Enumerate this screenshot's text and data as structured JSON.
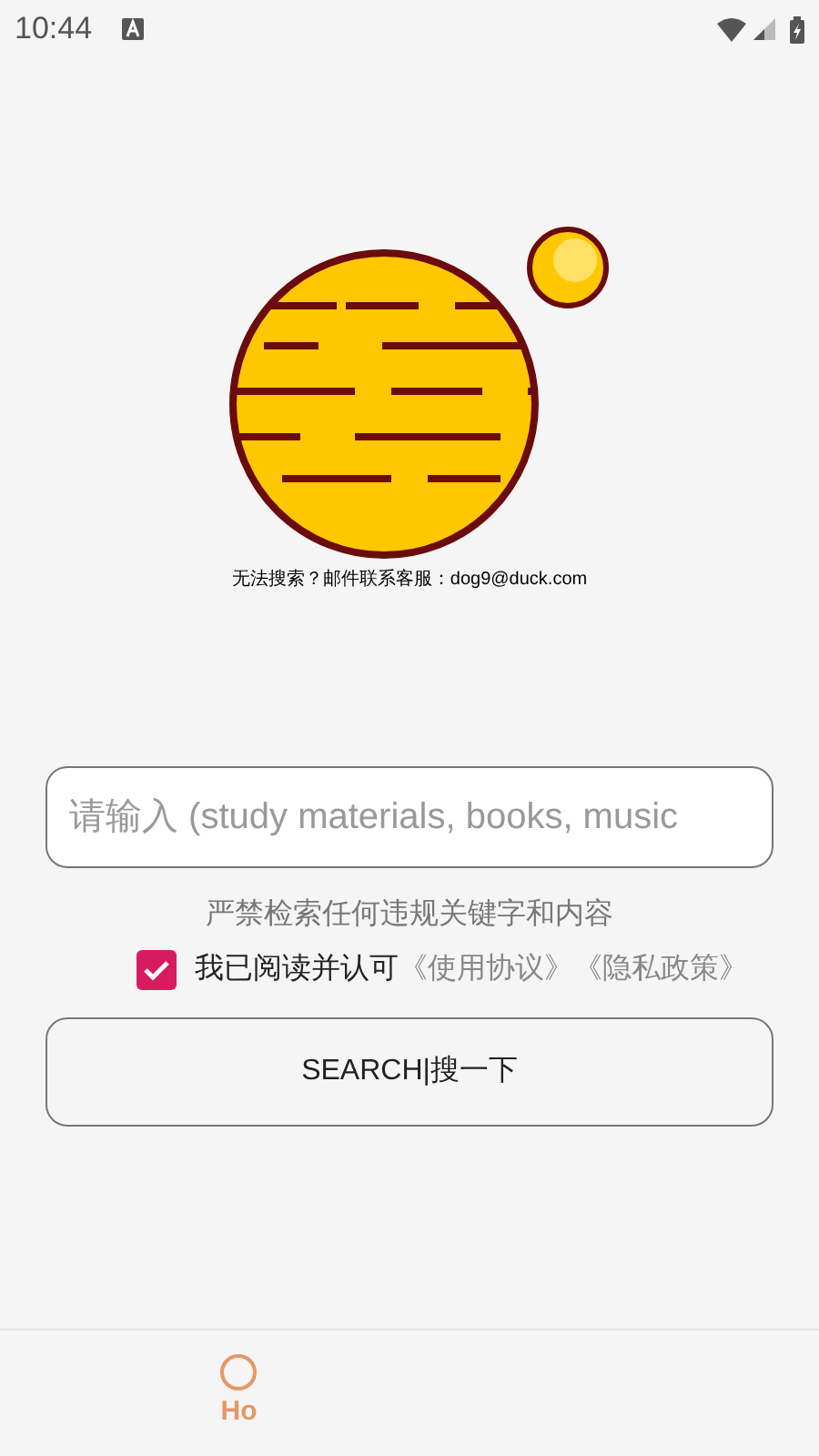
{
  "status_bar": {
    "time": "10:44"
  },
  "contact_note": "无法搜索？邮件联系客服：dog9@duck.com",
  "search": {
    "placeholder": "请输入 (study materials, books, music"
  },
  "warning": "严禁检索任何违规关键字和内容",
  "agreement": {
    "checked": true,
    "label": "我已阅读并认可",
    "links": [
      "《使用协议》",
      "《隐私政策》"
    ]
  },
  "search_button": "SEARCH|搜一下",
  "bottom_nav": [
    {
      "label": "Ho",
      "selected": true
    }
  ]
}
